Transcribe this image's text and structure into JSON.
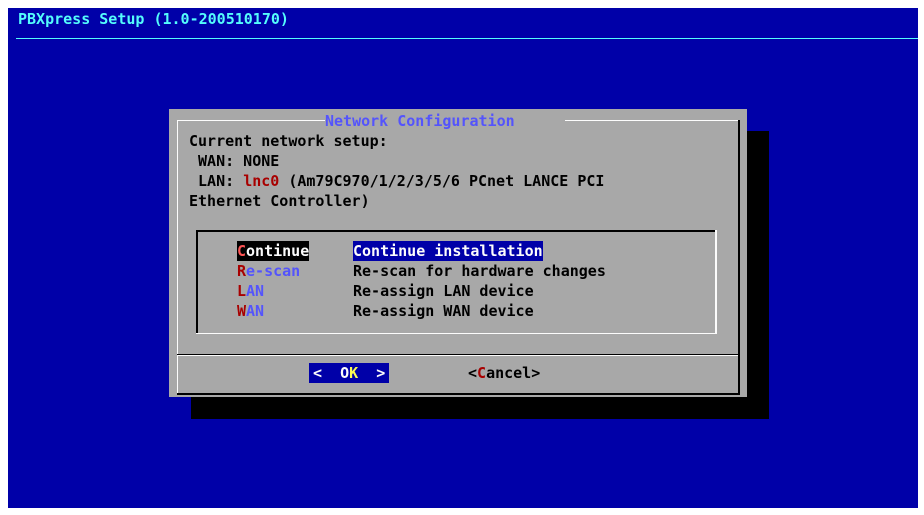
{
  "backtitle": "PBXpress Setup (1.0-200510170)",
  "dialog": {
    "title": "Network Configuration",
    "line1": "Current network setup:",
    "wan_line": " WAN: NONE",
    "lan_prefix": " LAN: ",
    "lan_device": "lnc0",
    "lan_suffix": " (Am79C970/1/2/3/5/6 PCnet LANCE PCI",
    "lan_line2": "Ethernet Controller)"
  },
  "menu": {
    "items": [
      {
        "hotkey": "C",
        "tag_rest": "ontinue",
        "description": "Continue installation",
        "selected": true
      },
      {
        "hotkey": "R",
        "tag_rest": "e-scan",
        "description": "Re-scan for hardware changes",
        "selected": false
      },
      {
        "hotkey": "L",
        "tag_rest": "AN",
        "description": "Re-assign LAN device",
        "selected": false
      },
      {
        "hotkey": "W",
        "tag_rest": "AN",
        "description": "Re-assign WAN device",
        "selected": false
      }
    ]
  },
  "buttons": {
    "ok": {
      "prefix": "<  ",
      "first": "O",
      "hotkey": "K",
      "suffix": "  >"
    },
    "cancel": {
      "open": "<",
      "hotkey": "C",
      "rest": "ancel",
      "close": ">"
    }
  },
  "colors": {
    "background": "#0000a8",
    "dialog": "#a8a8a8",
    "title_text": "#54fcfc",
    "hotkey": "#a80000"
  }
}
